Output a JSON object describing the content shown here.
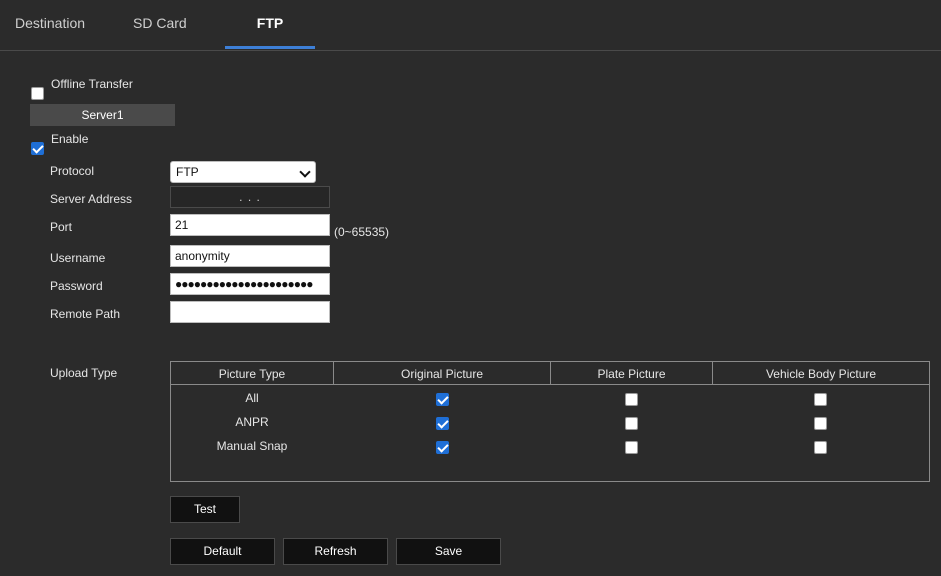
{
  "tabs": [
    {
      "label": "Destination"
    },
    {
      "label": "SD Card"
    },
    {
      "label": "FTP"
    }
  ],
  "offline_transfer": {
    "label": "Offline Transfer",
    "checked": false
  },
  "server_tab": "Server1",
  "enable": {
    "label": "Enable",
    "checked": true
  },
  "form": {
    "protocol": {
      "label": "Protocol",
      "value": "FTP"
    },
    "server_address": {
      "label": "Server Address",
      "value": ".      .      ."
    },
    "port": {
      "label": "Port",
      "value": "21",
      "hint": "(0~65535)"
    },
    "username": {
      "label": "Username",
      "value": "anonymity"
    },
    "password": {
      "label": "Password",
      "value": "●●●●●●●●●●●●●●●●●●●●●●"
    },
    "remote_path": {
      "label": "Remote Path",
      "value": ""
    }
  },
  "upload_type": {
    "label": "Upload Type",
    "columns": [
      "Picture Type",
      "Original Picture",
      "Plate Picture",
      "Vehicle Body Picture"
    ],
    "rows": [
      {
        "type": "All",
        "original": true,
        "plate": false,
        "body": false
      },
      {
        "type": "ANPR",
        "original": true,
        "plate": false,
        "body": false
      },
      {
        "type": "Manual Snap",
        "original": true,
        "plate": false,
        "body": false
      }
    ]
  },
  "buttons": {
    "test": "Test",
    "default": "Default",
    "refresh": "Refresh",
    "save": "Save"
  },
  "colors": {
    "accent": "#3d7fd6",
    "background": "#2b2b2b",
    "checkbox_checked": "#1f6fd6"
  }
}
